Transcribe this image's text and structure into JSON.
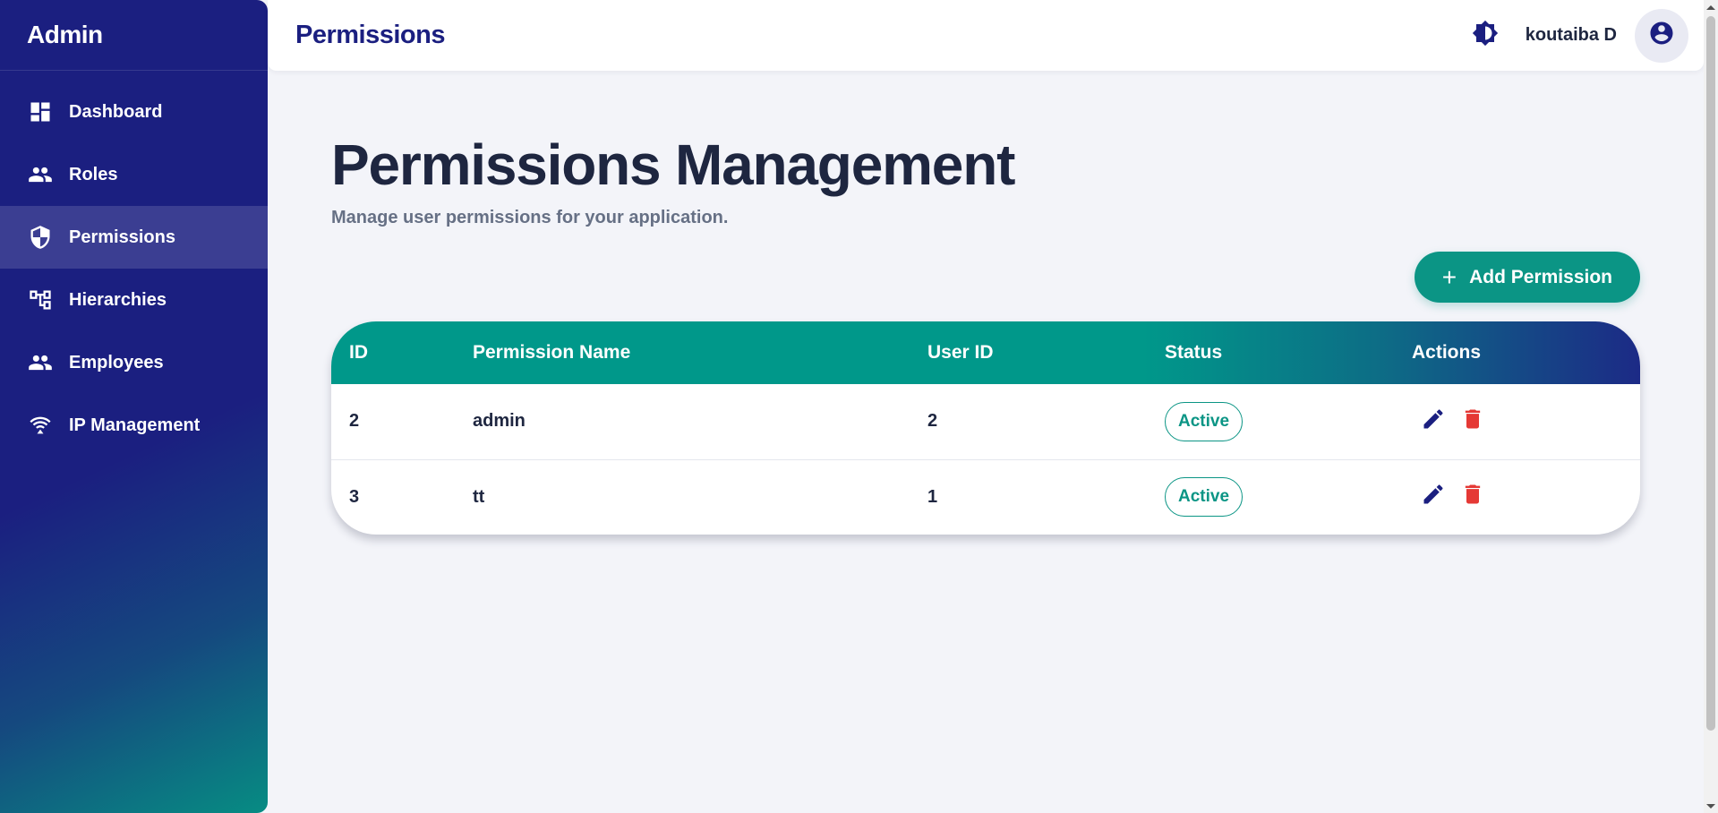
{
  "app": {
    "brand": "Admin"
  },
  "sidebar": {
    "items": [
      {
        "label": "Dashboard",
        "icon": "dashboard-icon",
        "active": false
      },
      {
        "label": "Roles",
        "icon": "people-icon",
        "active": false
      },
      {
        "label": "Permissions",
        "icon": "shield-icon",
        "active": true
      },
      {
        "label": "Hierarchies",
        "icon": "hierarchy-icon",
        "active": false
      },
      {
        "label": "Employees",
        "icon": "people-icon",
        "active": false
      },
      {
        "label": "IP Management",
        "icon": "network-icon",
        "active": false
      }
    ]
  },
  "header": {
    "title": "Permissions",
    "username": "koutaiba D",
    "theme_icon": "brightness-icon",
    "avatar_icon": "account-circle-icon"
  },
  "main": {
    "title": "Permissions Management",
    "subtitle": "Manage user permissions for your application.",
    "add_button_label": "Add Permission",
    "table": {
      "columns": [
        "ID",
        "Permission Name",
        "User ID",
        "Status",
        "Actions"
      ],
      "rows": [
        {
          "id": "2",
          "name": "admin",
          "user_id": "2",
          "status": "Active"
        },
        {
          "id": "3",
          "name": "tt",
          "user_id": "1",
          "status": "Active"
        }
      ]
    }
  },
  "colors": {
    "sidebar": "#1b1f80",
    "accent": "#0b9585",
    "delete": "#e53935",
    "edit": "#1b1f80"
  }
}
